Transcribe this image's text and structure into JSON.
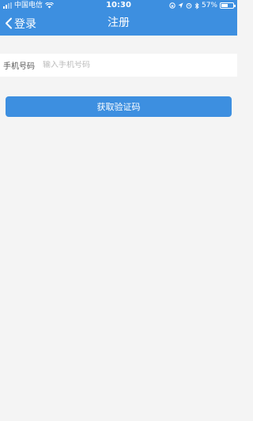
{
  "status_bar": {
    "carrier": "中国电信",
    "time": "10:30",
    "battery_percent": "57%",
    "battery_level": 0.57,
    "icons": [
      "signal-icon",
      "wifi-icon",
      "lock-rotation-icon",
      "location-icon",
      "alarm-icon",
      "bluetooth-icon",
      "battery-icon"
    ]
  },
  "nav": {
    "back_label": "登录",
    "title": "注册",
    "back_icon": "chevron-left-icon"
  },
  "form": {
    "phone_label": "手机号码",
    "phone_placeholder": "输入手机号码",
    "phone_value": "",
    "submit_label": "获取验证码"
  },
  "colors": {
    "primary": "#3d8fe0",
    "background": "#f4f4f4",
    "field_background": "#ffffff",
    "placeholder": "#bbbbbb"
  }
}
